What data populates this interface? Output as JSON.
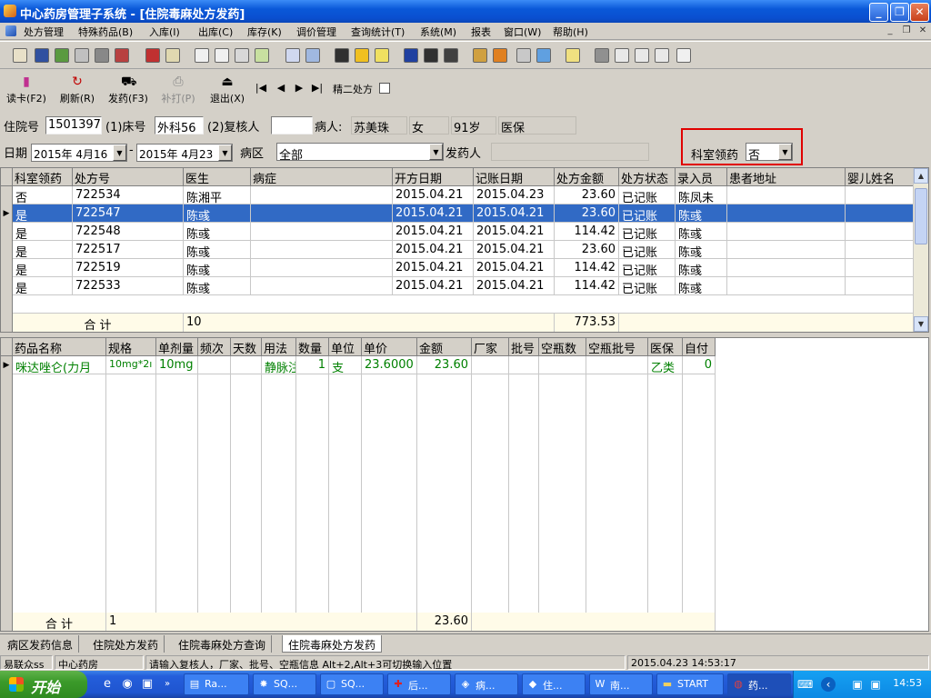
{
  "window": {
    "title": "中心药房管理子系统 - [住院毒麻处方发药]",
    "buttons": [
      "_",
      "❐",
      "✕"
    ]
  },
  "menu": {
    "items": [
      "处方管理",
      "特殊药品(B)",
      "入库(I)",
      "出库(C)",
      "库存(K)",
      "调价管理",
      "查询统计(T)",
      "系统(M)",
      "报表",
      "窗口(W)",
      "帮助(H)"
    ],
    "mdi": [
      "_",
      "❐",
      "✕"
    ]
  },
  "toolbar2": {
    "buttons": [
      {
        "label": "读卡(F2)",
        "icon": "▮",
        "enabled": true
      },
      {
        "label": "刷新(R)",
        "icon": "↻",
        "enabled": true
      },
      {
        "label": "发药(F3)",
        "icon": "⛟",
        "enabled": true
      },
      {
        "label": "补打(P)",
        "icon": "⎙",
        "enabled": false
      },
      {
        "label": "退出(X)",
        "icon": "⏏",
        "enabled": true
      }
    ],
    "nav": [
      "|◀",
      "◀",
      "▶",
      "▶|"
    ],
    "jinger_label": "精二处方"
  },
  "form": {
    "inpatient_no_label": "住院号",
    "inpatient_no": "1501397",
    "bed_label": "(1)床号",
    "bed": "外科56",
    "reviewer_label": "(2)复核人",
    "reviewer": "",
    "patient_label": "病人:",
    "patient_name": "苏美珠",
    "sex": "女",
    "age": "91岁",
    "insurance": "医保",
    "date_label": "日期",
    "date_from": "2015年 4月16",
    "date_sep": "-",
    "date_to": "2015年 4月23",
    "ward_label": "病区",
    "ward": "全部",
    "dispenser_label": "发药人",
    "dispenser": "",
    "dept_collect_label": "科室领药",
    "dept_collect": "否"
  },
  "prescriptions": {
    "columns": [
      "科室领药",
      "处方号",
      "医生",
      "病症",
      "开方日期",
      "记账日期",
      "处方金额",
      "处方状态",
      "录入员",
      "患者地址",
      "婴儿姓名"
    ],
    "rows": [
      [
        "否",
        "722534",
        "陈湘平",
        "",
        "2015.04.21",
        "2015.04.23",
        "23.60",
        "已记账",
        "陈凤未",
        "",
        ""
      ],
      [
        "是",
        "722547",
        "陈彧",
        "",
        "2015.04.21",
        "2015.04.21",
        "23.60",
        "已记账",
        "陈彧",
        "",
        ""
      ],
      [
        "是",
        "722548",
        "陈彧",
        "",
        "2015.04.21",
        "2015.04.21",
        "114.42",
        "已记账",
        "陈彧",
        "",
        ""
      ],
      [
        "是",
        "722517",
        "陈彧",
        "",
        "2015.04.21",
        "2015.04.21",
        "23.60",
        "已记账",
        "陈彧",
        "",
        ""
      ],
      [
        "是",
        "722519",
        "陈彧",
        "",
        "2015.04.21",
        "2015.04.21",
        "114.42",
        "已记账",
        "陈彧",
        "",
        ""
      ],
      [
        "是",
        "722533",
        "陈彧",
        "",
        "2015.04.21",
        "2015.04.21",
        "114.42",
        "已记账",
        "陈彧",
        "",
        ""
      ]
    ],
    "selected_row": 1,
    "sum_label": "合 计",
    "sum_count": "10",
    "sum_amount": "773.53"
  },
  "details": {
    "columns": [
      "药品名称",
      "规格",
      "单剂量",
      "频次",
      "天数",
      "用法",
      "数量",
      "单位",
      "单价",
      "金额",
      "厂家",
      "批号",
      "空瓶数",
      "空瓶批号",
      "医保",
      "自付"
    ],
    "rows": [
      [
        "咪达唑仑(力月",
        "10mg*2ı",
        "10mg",
        "",
        "",
        "静脉注",
        "1",
        "支",
        "23.6000",
        "23.60",
        "",
        "",
        "",
        "",
        "乙类",
        "0"
      ]
    ],
    "sum_label": "合 计",
    "sum_count": "1",
    "sum_amount": "23.60"
  },
  "tabs": [
    "病区发药信息",
    "住院处方发药",
    "住院毒麻处方查询",
    "住院毒麻处方发药"
  ],
  "active_tab": 3,
  "status": {
    "user": "易联众ss",
    "dept": "中心药房",
    "hint": "请输入复核人，厂家、批号、空瓶信息  Alt+2,Alt+3可切换输入位置",
    "datetime": "2015.04.23 14:53:17"
  },
  "taskbar": {
    "start": "开始",
    "tasks": [
      "Ra...",
      "SQ...",
      "SQ...",
      "后...",
      "病...",
      "住...",
      "南...",
      "START",
      "药..."
    ],
    "clock": "14:53"
  },
  "colors": {
    "selection": "#316ac5",
    "highlight_box": "#e00000",
    "detail_text": "#008000"
  }
}
